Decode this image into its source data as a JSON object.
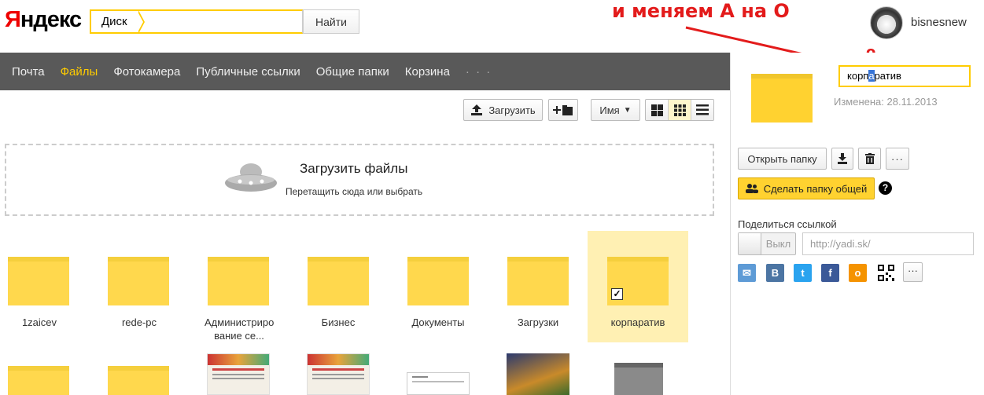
{
  "header": {
    "logo_first": "Я",
    "logo_rest": "ндекс",
    "search_tag": "Диск",
    "search_value": "",
    "search_button": "Найти",
    "username": "bisnesnew"
  },
  "annotation": {
    "text": "и меняем А на О",
    "small_letter": "о",
    "color": "#e31b1b"
  },
  "nav": {
    "items": [
      "Почта",
      "Файлы",
      "Фотокамера",
      "Публичные ссылки",
      "Общие папки",
      "Корзина",
      "· · ·"
    ],
    "active_index": 1
  },
  "toolbar": {
    "upload_label": "Загрузить",
    "sort_label": "Имя"
  },
  "dropzone": {
    "title": "Загрузить файлы",
    "subtitle": "Перетащить сюда или выбрать"
  },
  "folders": [
    {
      "name": "1zaicev"
    },
    {
      "name": "rede-pc"
    },
    {
      "name": "Администриро вание се..."
    },
    {
      "name": "Бизнес"
    },
    {
      "name": "Документы"
    },
    {
      "name": "Загрузки"
    },
    {
      "name": "корпаратив",
      "selected": true
    }
  ],
  "panel": {
    "rename_before": "корп",
    "rename_highlight": "а",
    "rename_after": "ратив",
    "modified": "Изменена: 28.11.2013",
    "open_label": "Открыть папку",
    "more_label": "···",
    "share_button": "Сделать папку общей",
    "help": "?",
    "share_link_label": "Поделиться ссылкой",
    "toggle_label": "Выкл",
    "link_placeholder": "http://yadi.sk/",
    "social": [
      {
        "icon": "mail-icon",
        "glyph": "✉",
        "color": "#5e9bd6"
      },
      {
        "icon": "vk-icon",
        "glyph": "В",
        "color": "#4c75a3"
      },
      {
        "icon": "twitter-icon",
        "glyph": "t",
        "color": "#2aa3ef"
      },
      {
        "icon": "facebook-icon",
        "glyph": "f",
        "color": "#3b5998"
      },
      {
        "icon": "odnoklassniki-icon",
        "glyph": "о",
        "color": "#f59300"
      }
    ],
    "social_more": "···"
  },
  "colors": {
    "accent": "#ffcc00",
    "nav_bg": "#595959",
    "folder": "#ffd84d"
  }
}
